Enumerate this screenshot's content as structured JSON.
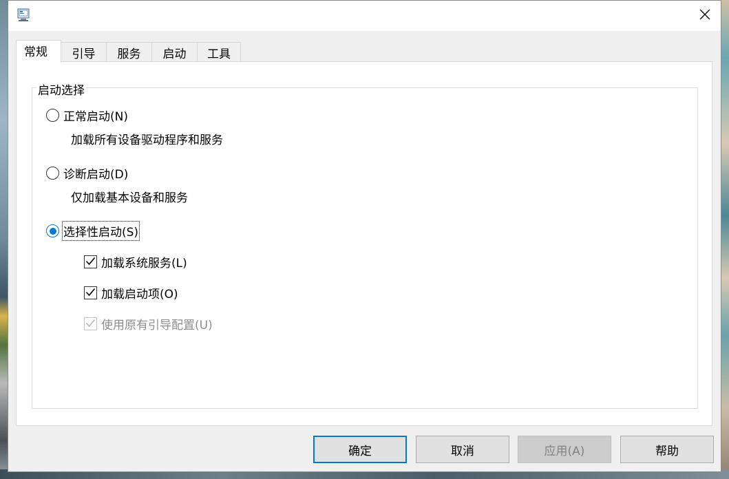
{
  "tabs": [
    {
      "label": "常规"
    },
    {
      "label": "引导"
    },
    {
      "label": "服务"
    },
    {
      "label": "启动"
    },
    {
      "label": "工具"
    }
  ],
  "startup_selection": {
    "legend": "启动选择",
    "normal": {
      "label": "正常启动(N)",
      "description": "加载所有设备驱动程序和服务",
      "checked": false
    },
    "diagnostic": {
      "label": "诊断启动(D)",
      "description": "仅加载基本设备和服务",
      "checked": false
    },
    "selective": {
      "label": "选择性启动(S)",
      "checked": true
    },
    "options": [
      {
        "label": "加载系统服务(L)",
        "checked": true,
        "enabled": true
      },
      {
        "label": "加载启动项(O)",
        "checked": true,
        "enabled": true
      },
      {
        "label": "使用原有引导配置(U)",
        "checked": true,
        "enabled": false
      }
    ]
  },
  "buttons": {
    "ok": "确定",
    "cancel": "取消",
    "apply": "应用(A)",
    "help": "帮助"
  },
  "colors": {
    "accent": "#0078d7",
    "window_bg": "#f0f0f0",
    "panel_bg": "#ffffff",
    "disabled_text": "#8d8d8d"
  },
  "icons": {
    "app": "system-config-icon",
    "close": "close-icon",
    "check": "checkmark-icon"
  }
}
